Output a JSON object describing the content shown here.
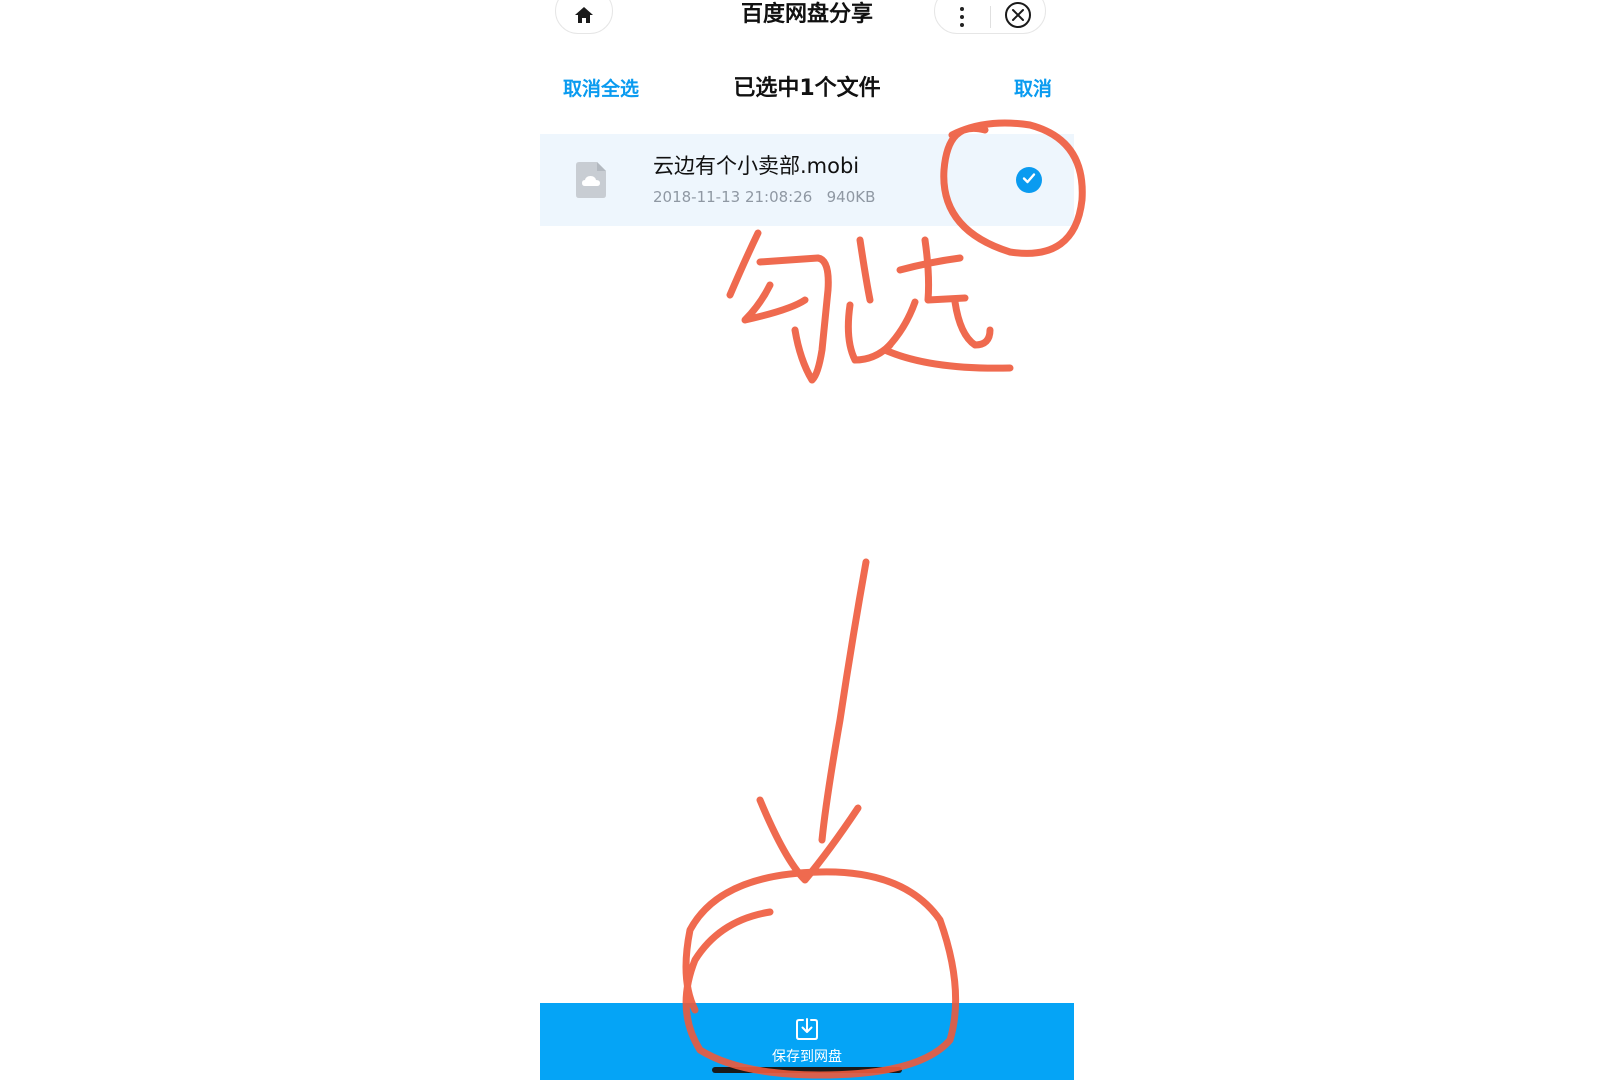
{
  "topbar": {
    "title": "百度网盘分享",
    "home_icon": "home-icon",
    "more_icon": "more-dots-icon",
    "close_icon": "close-circle-icon"
  },
  "selection_header": {
    "deselect_all_label": "取消全选",
    "title": "已选中1个文件",
    "cancel_label": "取消"
  },
  "files": [
    {
      "name": "云边有个小卖部.mobi",
      "datetime": "2018-11-13 21:08:26",
      "size": "940KB",
      "selected": true,
      "icon": "cloud-file-icon"
    }
  ],
  "save_bar": {
    "label": "保存到网盘",
    "icon": "download-tray-icon"
  },
  "annotation": {
    "text": "勾选",
    "color": "#ee5a3c"
  },
  "colors": {
    "accent": "#0a9bf0",
    "save_bar": "#05a4f6",
    "selected_row": "#eef6fd"
  }
}
